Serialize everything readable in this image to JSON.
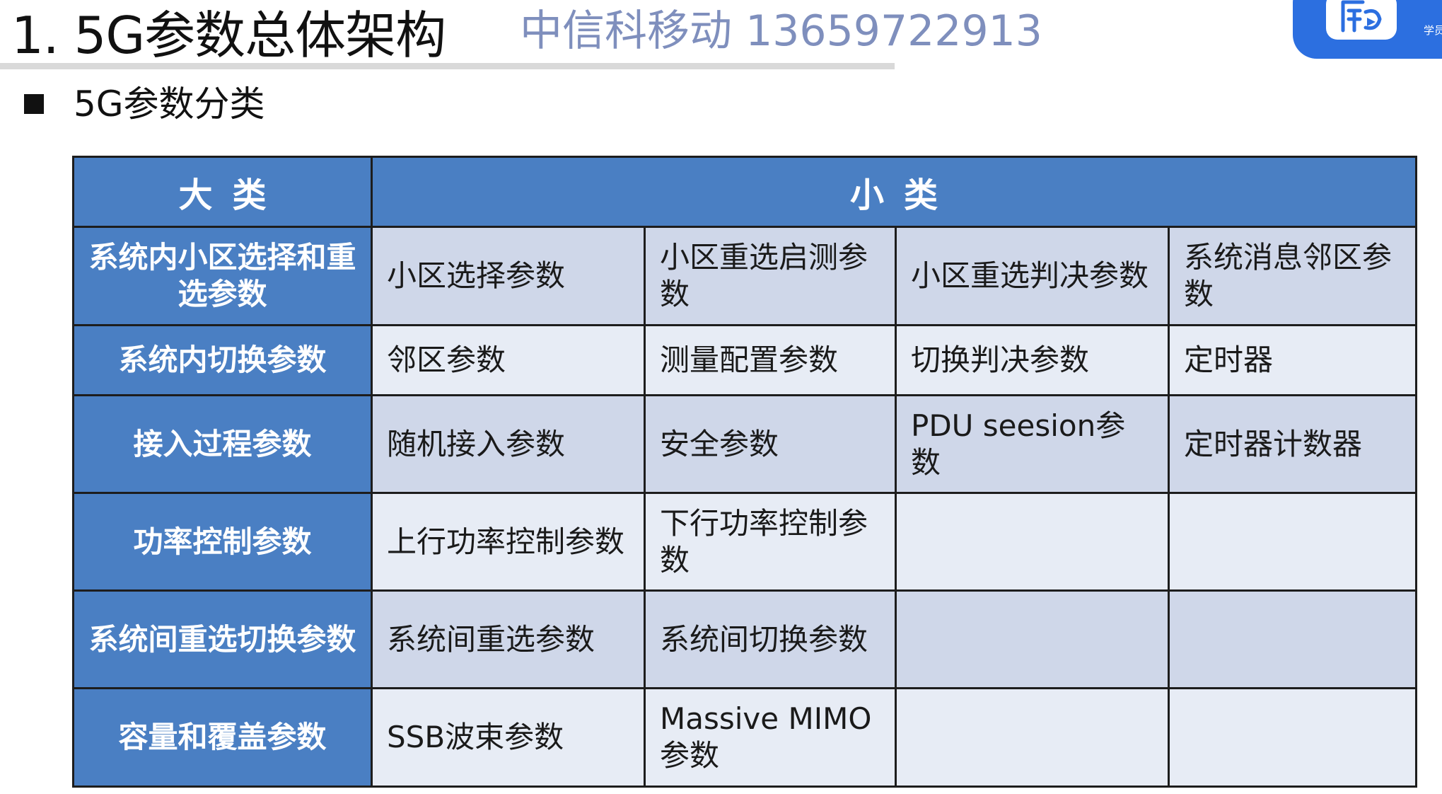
{
  "header": {
    "title": "1. 5G参数总体架构",
    "watermark": "中信科移动 13659722913",
    "corner_logo_text": "学员"
  },
  "section": {
    "bullet": "5G参数分类"
  },
  "table": {
    "header": {
      "major": "大类",
      "minor": "小类"
    },
    "rows": [
      {
        "category": "系统内小区选择和重选参数",
        "subs": [
          "小区选择参数",
          "小区重选启测参数",
          "小区重选判决参数",
          "系统消息邻区参数"
        ]
      },
      {
        "category": "系统内切换参数",
        "subs": [
          "邻区参数",
          "测量配置参数",
          "切换判决参数",
          "定时器"
        ]
      },
      {
        "category": "接入过程参数",
        "subs": [
          "随机接入参数",
          "安全参数",
          "PDU seesion参数",
          "定时器计数器"
        ]
      },
      {
        "category": "功率控制参数",
        "subs": [
          "上行功率控制参数",
          "下行功率控制参数",
          "",
          ""
        ]
      },
      {
        "category": "系统间重选切换参数",
        "subs": [
          "系统间重选参数",
          "系统间切换参数",
          "",
          ""
        ]
      },
      {
        "category": "容量和覆盖参数",
        "subs": [
          "SSB波束参数",
          "Massive MIMO参数",
          "",
          ""
        ]
      }
    ]
  },
  "colors": {
    "header_blue": "#4a7fc3",
    "row_dark": "#cfd7e9",
    "row_light": "#e7ecf5",
    "watermark": "#7f8fbd",
    "logo_blue": "#2c6fe0"
  }
}
